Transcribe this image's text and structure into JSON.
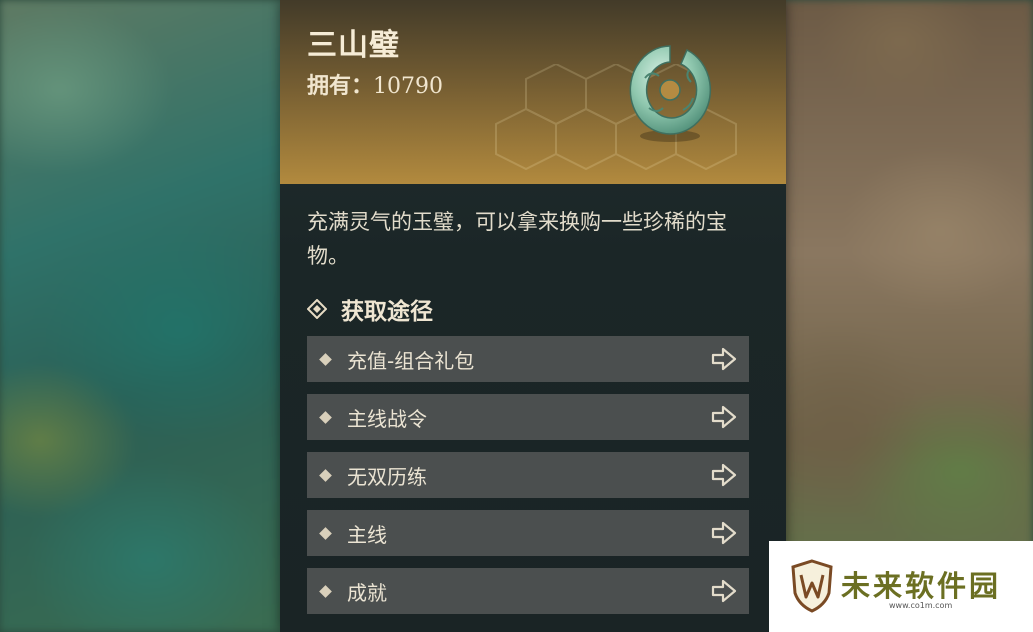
{
  "item": {
    "name": "三山璧",
    "owned_label": "拥有：",
    "owned_count": "10790",
    "description": "充满灵气的玉璧，可以拿来换购一些珍稀的宝物。",
    "icon": "jade-bi-disc-icon"
  },
  "sources": {
    "title": "获取途径",
    "items": [
      {
        "label": "充值-组合礼包"
      },
      {
        "label": "主线战令"
      },
      {
        "label": "无双历练"
      },
      {
        "label": "主线"
      },
      {
        "label": "成就"
      }
    ]
  },
  "watermark": {
    "text": "未来软件园",
    "url": "www.co1m.com"
  },
  "colors": {
    "header_gold": "#b28a3e",
    "panel_bg": "#1b2627",
    "row_bg": "#4b4f4f",
    "text_light": "#ebe4d3",
    "watermark_olive": "#6b6f22"
  }
}
